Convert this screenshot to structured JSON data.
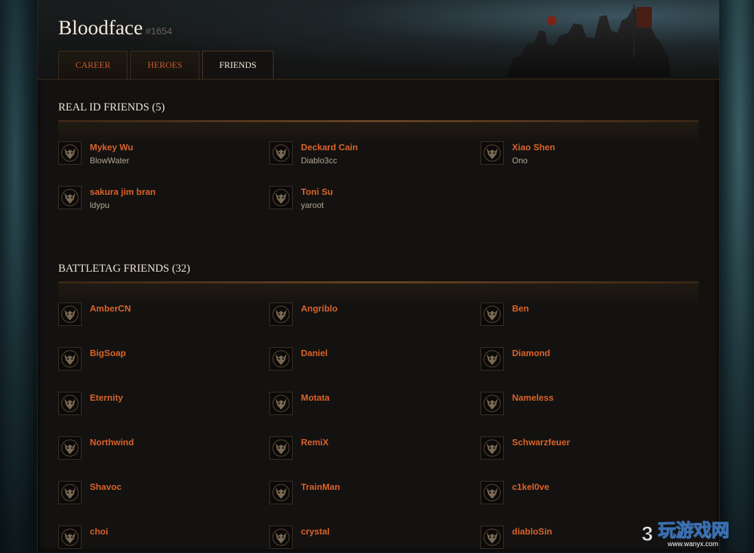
{
  "profile": {
    "name": "Bloodface",
    "tag": "#1654"
  },
  "tabs": [
    {
      "label": "CAREER",
      "active": false
    },
    {
      "label": "HEROES",
      "active": false
    },
    {
      "label": "FRIENDS",
      "active": true
    }
  ],
  "real_id": {
    "title": "REAL ID FRIENDS (5)",
    "friends": [
      {
        "name": "Mykey Wu",
        "battletag": "BlowWater"
      },
      {
        "name": "Deckard Cain",
        "battletag": "Diablo3cc"
      },
      {
        "name": "Xiao Shen",
        "battletag": "Ono"
      },
      {
        "name": "sakura jim bran",
        "battletag": "ldypu"
      },
      {
        "name": "Toni Su",
        "battletag": "yaroot"
      }
    ]
  },
  "battletag": {
    "title": "BATTLETAG FRIENDS (32)",
    "friends": [
      {
        "name": "AmberCN"
      },
      {
        "name": "Angriblo"
      },
      {
        "name": "Ben"
      },
      {
        "name": "BigSoap"
      },
      {
        "name": "Daniel"
      },
      {
        "name": "Diamond"
      },
      {
        "name": "Eternity"
      },
      {
        "name": "Motata"
      },
      {
        "name": "Nameless"
      },
      {
        "name": "Northwind"
      },
      {
        "name": "RemiX"
      },
      {
        "name": "Schwarzfeuer"
      },
      {
        "name": "Shavoc"
      },
      {
        "name": "TrainMan"
      },
      {
        "name": "c1kel0ve"
      },
      {
        "name": "choi"
      },
      {
        "name": "crystal"
      },
      {
        "name": "diabloSin"
      }
    ]
  },
  "watermark": {
    "text": "玩游戏网",
    "url": "www.wanyx.com",
    "prefix": "3"
  },
  "colors": {
    "accent": "#d9622a",
    "text": "#ece3d2",
    "muted": "#b3a895"
  }
}
